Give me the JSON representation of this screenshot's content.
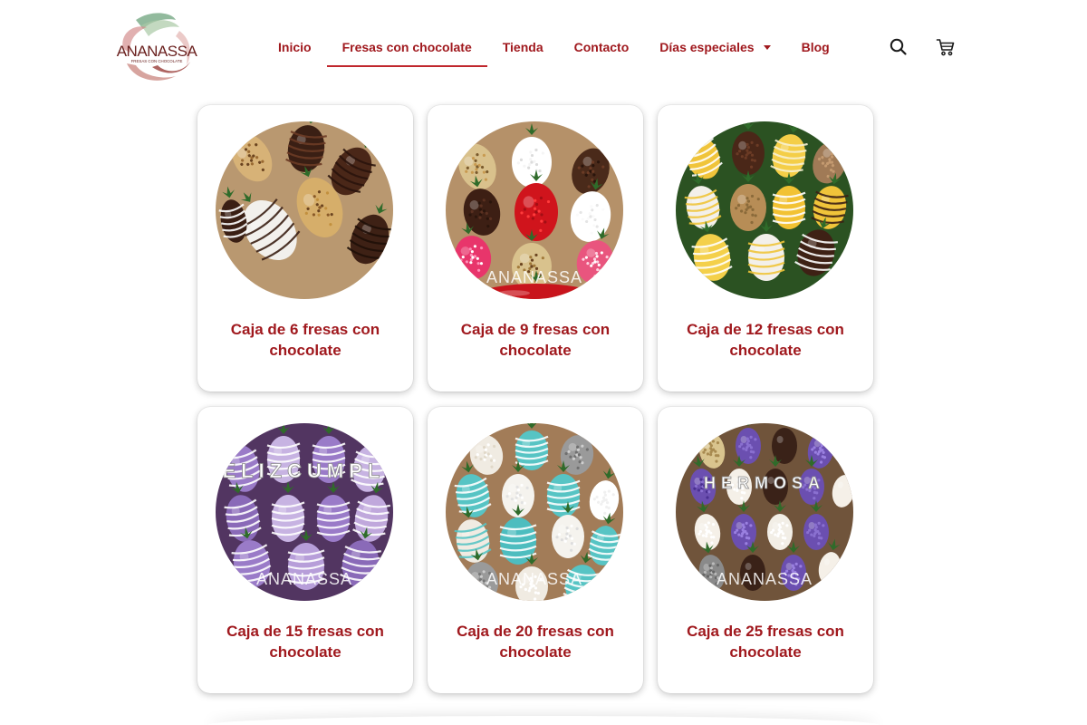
{
  "brand": {
    "name": "ANANASSA",
    "tagline": "FRESAS CON CHOCOLATE"
  },
  "nav": {
    "items": [
      {
        "label": "Inicio"
      },
      {
        "label": "Fresas con chocolate",
        "active": true
      },
      {
        "label": "Tienda"
      },
      {
        "label": "Contacto"
      },
      {
        "label": "Días especiales",
        "has_dropdown": true
      },
      {
        "label": "Blog"
      }
    ]
  },
  "header_icons": {
    "search": "search-icon",
    "cart": "cart-icon"
  },
  "products": [
    {
      "title": "Caja de 6 fresas con chocolate",
      "theme": "dark-chocolate-nuts",
      "watermark": ""
    },
    {
      "title": "Caja de 9 fresas con chocolate",
      "theme": "colorful-sprinkles",
      "watermark": "ANANASSA"
    },
    {
      "title": "Caja de 12 fresas con chocolate",
      "theme": "gold-yellow-white",
      "watermark": ""
    },
    {
      "title": "Caja de 15 fresas con chocolate",
      "theme": "purple-feliz-cumple",
      "watermark": "ANANASSA",
      "photo_text": [
        "F",
        "E",
        "L",
        "I",
        "Z",
        "C",
        "U",
        "M",
        "P",
        "L",
        "E"
      ]
    },
    {
      "title": "Caja de 20 fresas con chocolate",
      "theme": "turquoise-white-silver",
      "watermark": "ANANASSA"
    },
    {
      "title": "Caja de 25 fresas con chocolate",
      "theme": "purple-white-hermosa",
      "watermark": "ANANASSA",
      "photo_text": [
        "H",
        "E",
        "R",
        "M",
        "O",
        "S",
        "A"
      ]
    }
  ],
  "colors": {
    "accent": "#a0191e",
    "underline": "#c0272d",
    "card_bg": "#ffffff"
  }
}
